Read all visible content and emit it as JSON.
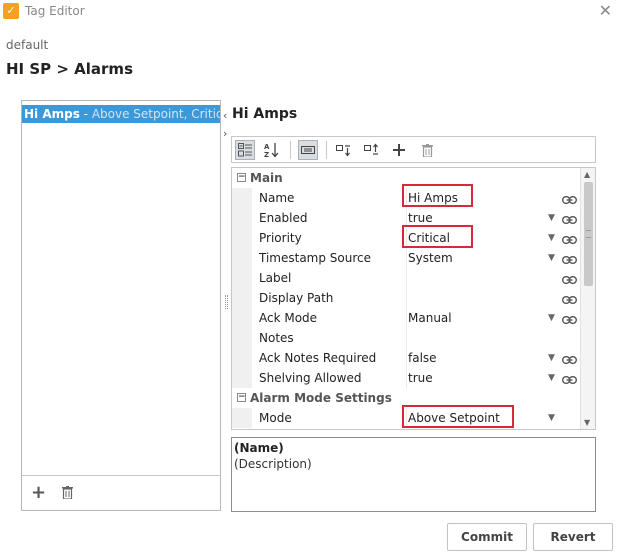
{
  "window": {
    "title": "Tag Editor",
    "app_icon": "ignition-icon",
    "close_icon": "close-icon"
  },
  "provider": "default",
  "path": "HI SP > Alarms",
  "alarm_list": {
    "items": [
      {
        "name": "Hi Amps",
        "separator": " - ",
        "summary": "Above Setpoint, Critical"
      }
    ]
  },
  "detail": {
    "title": "Hi Amps"
  },
  "toolbar": {
    "icons": [
      "categorized-view-icon",
      "alphabetical-sort-icon",
      "keyboard-icon",
      "move-down-icon",
      "move-up-icon",
      "add-icon",
      "delete-icon"
    ]
  },
  "properties": {
    "main_section": "Main",
    "rows": [
      {
        "name": "Name",
        "value": "Hi Amps",
        "dropdown": false,
        "binding": true
      },
      {
        "name": "Enabled",
        "value": "true",
        "dropdown": true,
        "binding": true
      },
      {
        "name": "Priority",
        "value": "Critical",
        "dropdown": true,
        "binding": true
      },
      {
        "name": "Timestamp Source",
        "value": "System",
        "dropdown": true,
        "binding": true
      },
      {
        "name": "Label",
        "value": "",
        "dropdown": false,
        "binding": true
      },
      {
        "name": "Display Path",
        "value": "",
        "dropdown": false,
        "binding": true
      },
      {
        "name": "Ack Mode",
        "value": "Manual",
        "dropdown": true,
        "binding": true
      },
      {
        "name": "Notes",
        "value": "",
        "dropdown": false,
        "binding": false
      },
      {
        "name": "Ack Notes Required",
        "value": "false",
        "dropdown": true,
        "binding": true
      },
      {
        "name": "Shelving Allowed",
        "value": "true",
        "dropdown": true,
        "binding": true
      }
    ],
    "mode_section": "Alarm Mode Settings",
    "mode_rows": [
      {
        "name": "Mode",
        "value": "Above Setpoint",
        "dropdown": true,
        "binding": false
      }
    ]
  },
  "description": {
    "name": "(Name)",
    "text": "(Description)"
  },
  "buttons": {
    "commit": "Commit",
    "revert": "Revert"
  },
  "colors": {
    "selection": "#3d98d8",
    "highlight": "#d9283a",
    "app_icon": "#f4a21d"
  }
}
